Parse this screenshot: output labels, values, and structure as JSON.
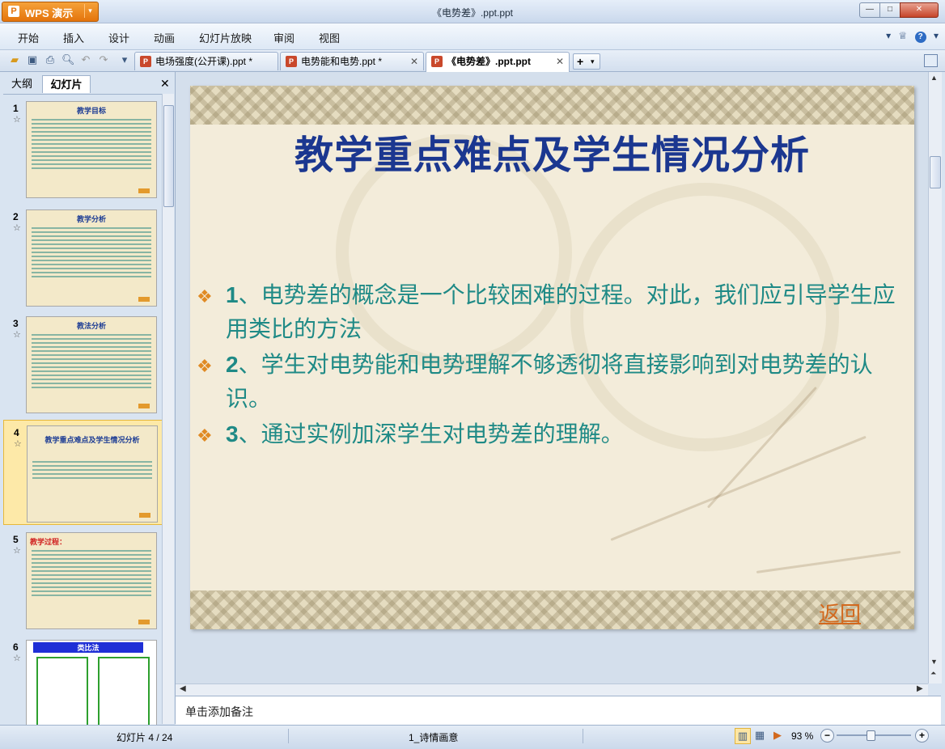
{
  "app": {
    "button_label": "WPS 演示",
    "window_title": "《电势差》.ppt.ppt"
  },
  "window_controls": {
    "minimize": "▭",
    "maximize": "□",
    "close": "✕"
  },
  "menu": [
    "开始",
    "插入",
    "设计",
    "动画",
    "幻灯片放映",
    "审阅",
    "视图"
  ],
  "menu_right": {
    "help": "?"
  },
  "doc_tabs": [
    {
      "label": "电场强度(公开课).ppt *"
    },
    {
      "label": "电势能和电势.ppt *"
    },
    {
      "label": "《电势差》.ppt.ppt"
    }
  ],
  "panel": {
    "tab_outline": "大纲",
    "tab_slides": "幻灯片"
  },
  "thumbnails": [
    {
      "num": "1",
      "title": "教学目标"
    },
    {
      "num": "2",
      "title": "教学分析"
    },
    {
      "num": "3",
      "title": "教法分析"
    },
    {
      "num": "4",
      "title": "教学重点难点及学生情况分析"
    },
    {
      "num": "5",
      "title": "教学过程："
    },
    {
      "num": "6",
      "title": "类比法"
    }
  ],
  "slide": {
    "title": "教学重点难点及学生情况分析",
    "bullets": [
      {
        "num": "1",
        "text": "、电势差的概念是一个比较困难的过程。对此，我们应引导学生应用类比的方法"
      },
      {
        "num": "2",
        "text": "、学生对电势能和电势理解不够透彻将直接影响到对电势差的认识。"
      },
      {
        "num": "3",
        "text": "、通过实例加深学生对电势差的理解。"
      }
    ],
    "return_link": "返回"
  },
  "notes_placeholder": "单击添加备注",
  "status": {
    "slide_pos": "幻灯片 4 / 24",
    "theme": "1_诗情画意",
    "zoom": "93 %"
  },
  "zoom_level": 0.46,
  "colors": {
    "title_blue": "#1b3790",
    "bullet_teal": "#1f8a86",
    "accent_orange": "#e08a24"
  }
}
